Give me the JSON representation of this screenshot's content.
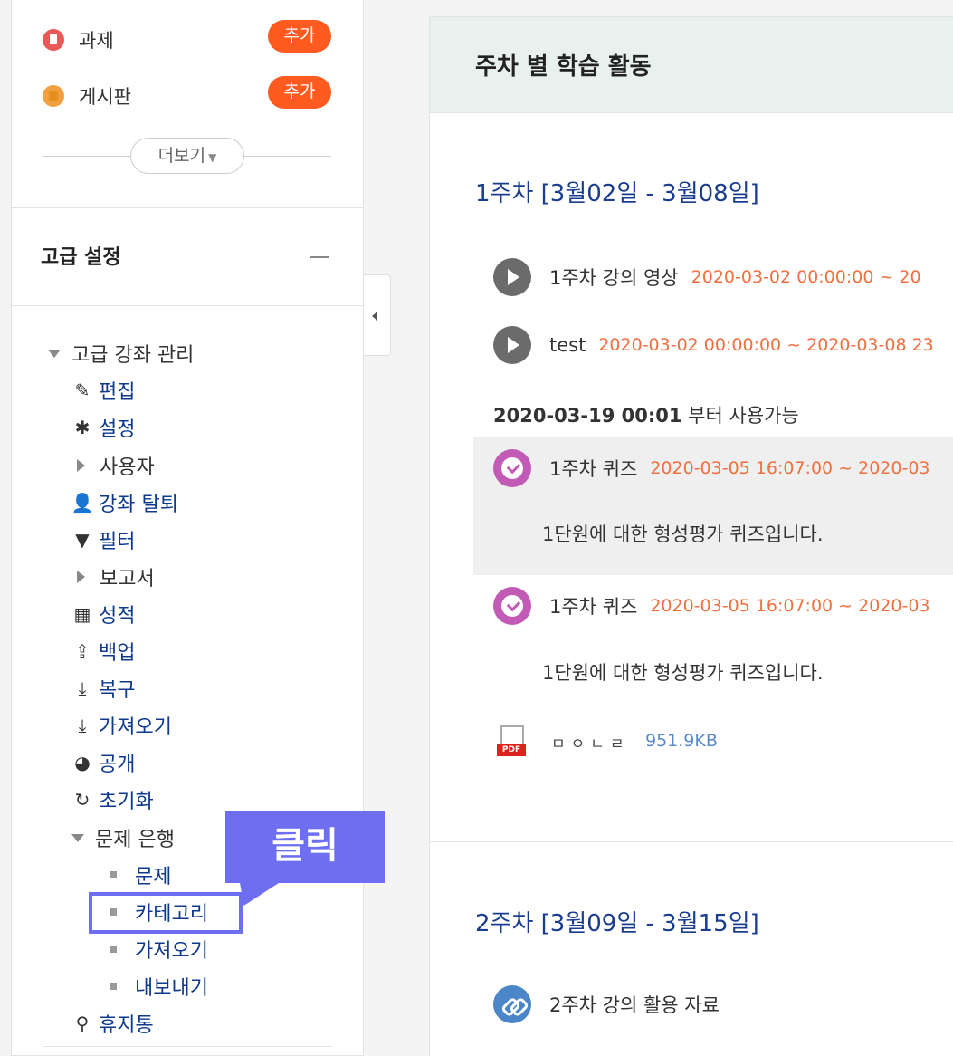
{
  "sidebar": {
    "add_items": [
      {
        "label": "과제",
        "button": "추가"
      },
      {
        "label": "게시판",
        "button": "추가"
      }
    ],
    "more_label": "더보기",
    "advanced_title": "고급 설정",
    "tree": {
      "root": "고급 강좌 관리",
      "edit": "편집",
      "settings": "설정",
      "users": "사용자",
      "unenrol": "강좌 탈퇴",
      "filters": "필터",
      "reports": "보고서",
      "grades": "성적",
      "backup": "백업",
      "restore": "복구",
      "import": "가져오기",
      "publish": "공개",
      "reset": "초기화",
      "question_bank": "문제 은행",
      "questions": "문제",
      "categories": "카테고리",
      "qb_import": "가져오기",
      "qb_export": "내보내기",
      "recycle_bin": "휴지통"
    }
  },
  "callout": {
    "text": "클릭"
  },
  "main": {
    "header_title": "주차 별 학습 활동",
    "week1": {
      "title": "1주차 [3월02일 - 3월08일]",
      "video": {
        "name": "1주차 강의 영상",
        "date": "2020-03-02 00:00:00 ~ 20"
      },
      "test": {
        "name": "test",
        "date": "2020-03-02 00:00:00 ~ 2020-03-08 23"
      },
      "availability_bold": "2020-03-19 00:01",
      "availability_rest": " 부터 사용가능",
      "quiz1": {
        "name": "1주차 퀴즈",
        "date": "2020-03-05 16:07:00 ~ 2020-03",
        "desc": "1단원에 대한 형성평가 퀴즈입니다."
      },
      "quiz2": {
        "name": "1주차 퀴즈",
        "date": "2020-03-05 16:07:00 ~ 2020-03",
        "desc": "1단원에 대한 형성평가 퀴즈입니다."
      },
      "file": {
        "name": "ㅁㅇㄴㄹ",
        "size": "951.9KB",
        "type_tag": "PDF"
      }
    },
    "week2": {
      "title": "2주차 [3월09일 - 3월15일]",
      "resource": {
        "name": "2주차 강의 활용 자료"
      }
    }
  },
  "colors": {
    "accent_orange": "#ff5a1f",
    "callout": "#6d6ff0",
    "link": "#0f3a8c",
    "date": "#f07040"
  }
}
